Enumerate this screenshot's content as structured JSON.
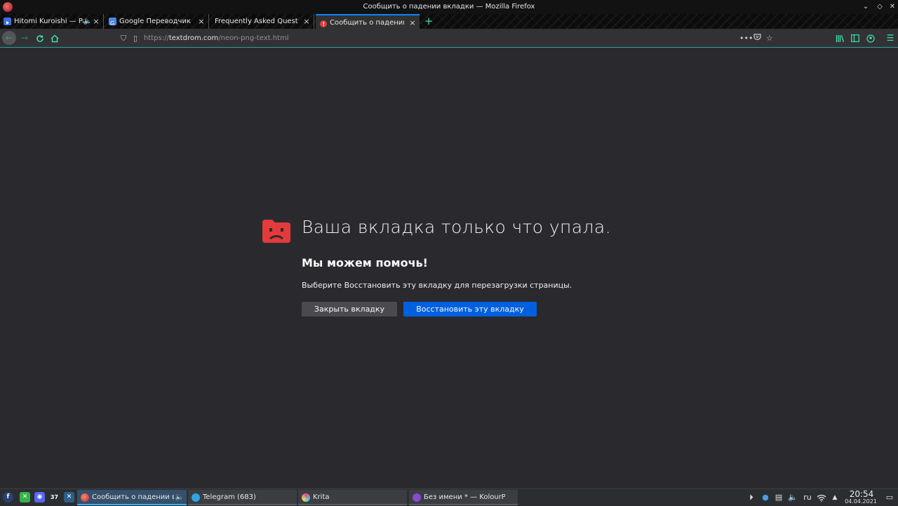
{
  "window": {
    "title": "Сообщить о падении вкладки — Mozilla Firefox"
  },
  "tabs": [
    {
      "label": "Hitomi Kuroishi — Pari",
      "favicon": "youtube-icon",
      "audio": true,
      "active": false
    },
    {
      "label": "Google Переводчик",
      "favicon": "google-translate-icon",
      "active": false
    },
    {
      "label": "Frequently Asked Questions",
      "favicon": "none",
      "active": false
    },
    {
      "label": "Сообщить о падении вкладки",
      "favicon": "crash-warning-icon",
      "active": true
    }
  ],
  "tab_close_glyph": "×",
  "new_tab_glyph": "+",
  "navbar": {
    "url_scheme": "https://",
    "url_host": "textdrom.com",
    "url_path": "/neon-png-text.html"
  },
  "crash": {
    "title": "Ваша вкладка только что упала.",
    "subtitle": "Мы можем помочь!",
    "description": "Выберите Восстановить эту вкладку для перезагрузки страницы.",
    "close_button": "Закрыть вкладку",
    "restore_button": "Восстановить эту вкладку"
  },
  "taskbar": {
    "tasks": [
      {
        "label": "Сообщить о падении в...",
        "icon": "firefox-icon",
        "active": true
      },
      {
        "label": "Telegram (683)",
        "icon": "telegram-icon",
        "active": false
      },
      {
        "label": "Krita",
        "icon": "krita-icon",
        "active": false
      },
      {
        "label": "Без имени * — KolourPaint",
        "icon": "kolourpaint-icon",
        "active": false
      }
    ],
    "launchers": [
      "fedora-icon",
      "app-green-icon",
      "discord-icon",
      "app-bw-icon",
      "vscode-icon"
    ],
    "layout": "ru",
    "time": "20:54",
    "date": "04.04.2021"
  },
  "colors": {
    "accent": "#3fe1b0",
    "crash_red": "#e33b3b",
    "restore_blue": "#0060df",
    "tab_active_line": "#0a84ff"
  }
}
